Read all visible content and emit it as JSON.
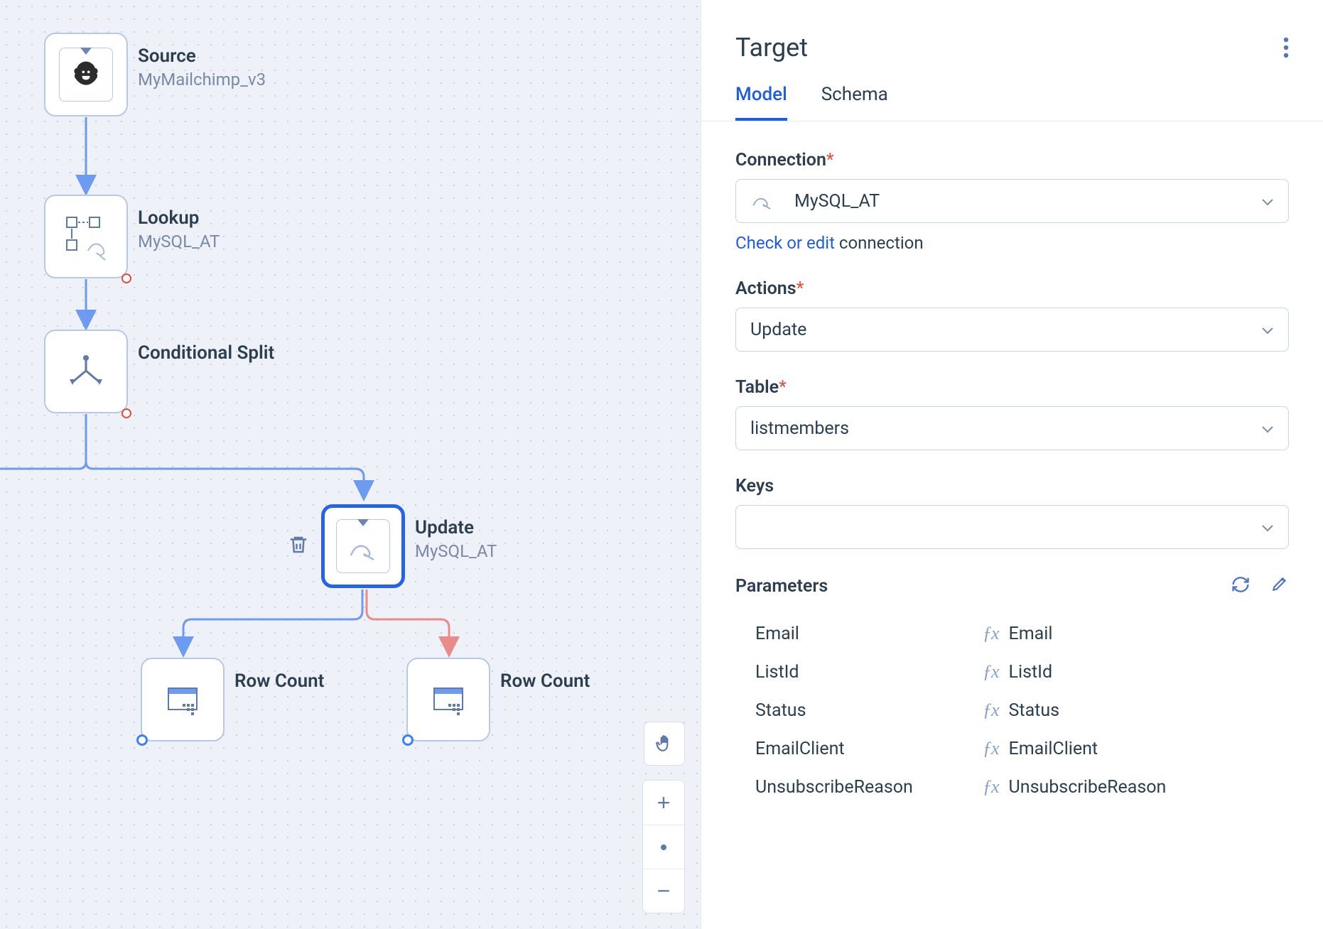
{
  "canvas": {
    "nodes": [
      {
        "id": "source",
        "title": "Source",
        "sub": "MyMailchimp_v3"
      },
      {
        "id": "lookup",
        "title": "Lookup",
        "sub": "MySQL_AT"
      },
      {
        "id": "split",
        "title": "Conditional Split",
        "sub": ""
      },
      {
        "id": "update",
        "title": "Update",
        "sub": "MySQL_AT"
      },
      {
        "id": "rc1",
        "title": "Row Count",
        "sub": ""
      },
      {
        "id": "rc2",
        "title": "Row Count",
        "sub": ""
      }
    ]
  },
  "panel": {
    "title": "Target",
    "tabs": {
      "model": "Model",
      "schema": "Schema"
    },
    "connection": {
      "label": "Connection",
      "value": "MySQL_AT",
      "helper_link": "Check or edit",
      "helper_rest": " connection"
    },
    "actions": {
      "label": "Actions",
      "value": "Update"
    },
    "table": {
      "label": "Table",
      "value": "listmembers"
    },
    "keys": {
      "label": "Keys",
      "value": ""
    },
    "paramsLabel": "Parameters",
    "params": [
      {
        "name": "Email",
        "value": "Email"
      },
      {
        "name": "ListId",
        "value": "ListId"
      },
      {
        "name": "Status",
        "value": "Status"
      },
      {
        "name": "EmailClient",
        "value": "EmailClient"
      },
      {
        "name": "UnsubscribeReason",
        "value": "UnsubscribeReason"
      }
    ]
  }
}
